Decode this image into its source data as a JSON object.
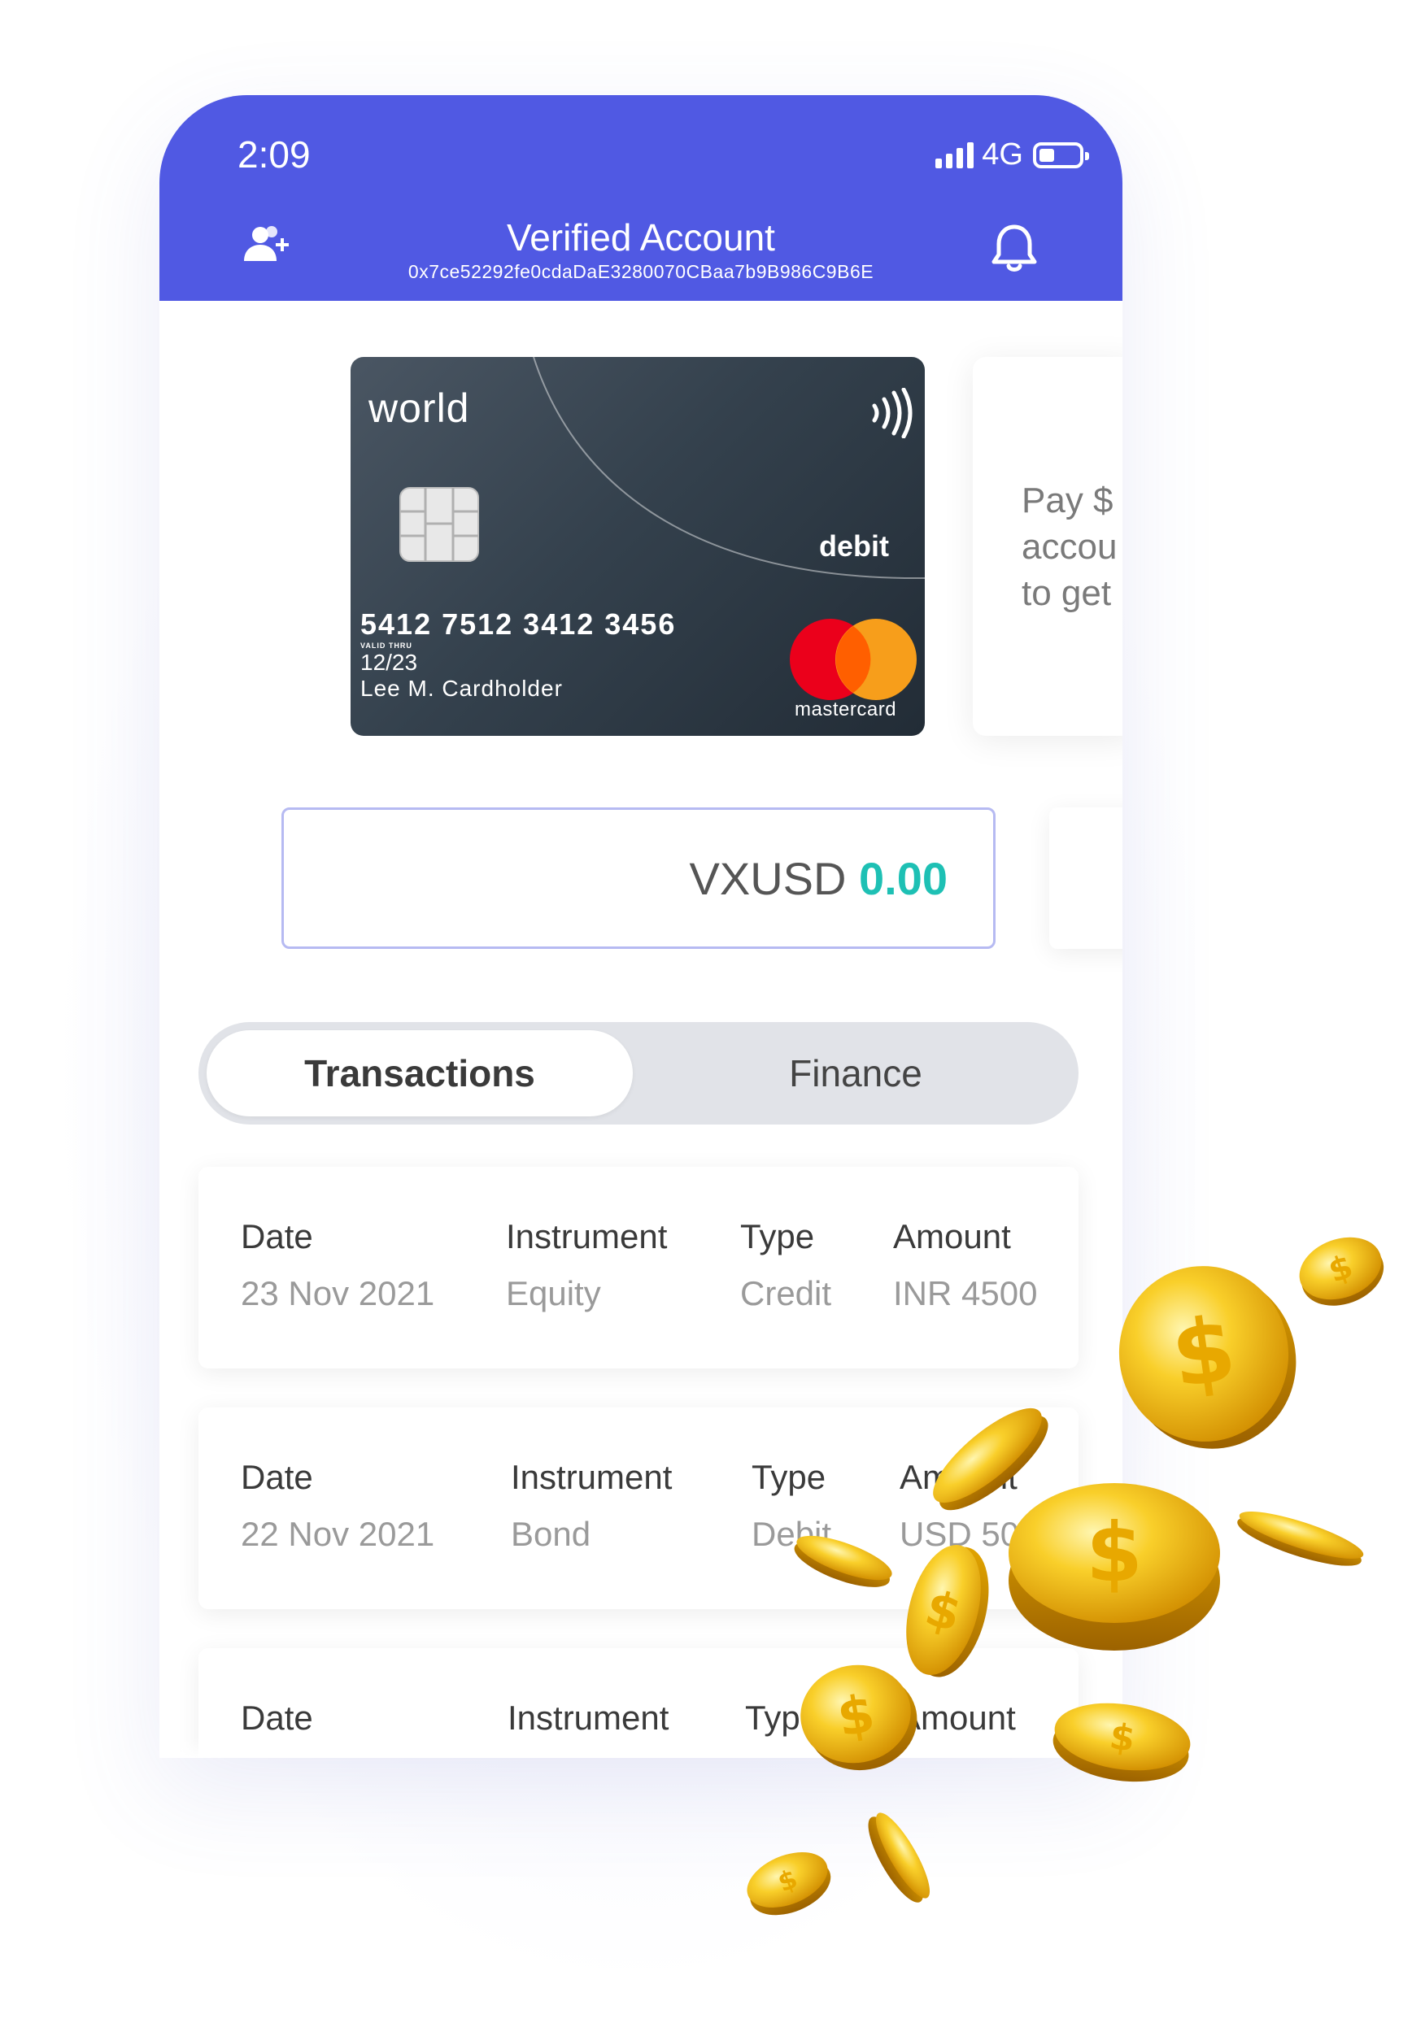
{
  "status_bar": {
    "time": "2:09",
    "network": "4G",
    "battery_level": 0.3
  },
  "header": {
    "title": "Verified Account",
    "address": "0x7ce52292fe0cdaDaE3280070CBaa7b9B986C9B6E",
    "left_icon": "add-user-icon",
    "right_icon": "bell-icon"
  },
  "card": {
    "brand": "world",
    "type": "debit",
    "number": "5412 7512 3412 3456",
    "valid_label": "VALID THRU",
    "expiry": "12/23",
    "holder": "Lee M. Cardholder",
    "network": "mastercard"
  },
  "side_card": {
    "text": "Pay $\naccou\nto get"
  },
  "balance": {
    "currency": "VXUSD",
    "amount": "0.00"
  },
  "tabs": [
    {
      "label": "Transactions",
      "active": true
    },
    {
      "label": "Finance",
      "active": false
    }
  ],
  "transactions": {
    "columns": [
      "Date",
      "Instrument",
      "Type",
      "Amount"
    ],
    "rows": [
      {
        "date": "23 Nov 2021",
        "instrument": "Equity",
        "type": "Credit",
        "amount": "INR 4500"
      },
      {
        "date": "22 Nov 2021",
        "instrument": "Bond",
        "type": "Debit",
        "amount": "USD 50"
      },
      {
        "date": "",
        "instrument": "",
        "type": "",
        "amount": ""
      }
    ]
  },
  "colors": {
    "header": "#5059e3",
    "balance_value": "#1ec0b4",
    "card": "#34414d",
    "coin": "#f2b800"
  }
}
